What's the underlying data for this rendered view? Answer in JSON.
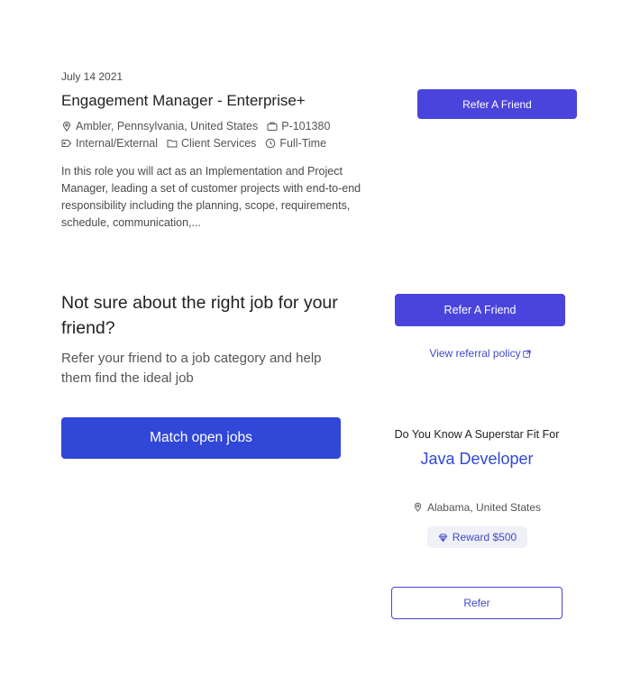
{
  "job": {
    "date": "July 14 2021",
    "title": "Engagement Manager - Enterprise+",
    "location": "Ambler, Pennsylvania, United States",
    "id": "P-101380",
    "type": "Internal/External",
    "department": "Client Services",
    "schedule": "Full-Time",
    "description": "In this role you will act as an Implementation and Project Manager, leading a set of customer projects with end-to-end responsibility including the planning, scope, requirements, schedule, communication,...",
    "refer_label": "Refer A Friend"
  },
  "not_sure": {
    "title": "Not sure about the right job for your friend?",
    "subtitle": "Refer your friend to a job category and help them find the ideal job",
    "match_label": "Match open jobs",
    "refer_label": "Refer A Friend",
    "policy_label": "View referral policy"
  },
  "superstar": {
    "heading": "Do You Know A Superstar Fit For",
    "role": "Java Developer",
    "location": "Alabama, United States",
    "reward": "Reward $500",
    "refer_label": "Refer"
  },
  "icons": {
    "location": "location-pin-icon",
    "id": "briefcase-icon",
    "type": "tag-icon",
    "department": "folder-icon",
    "schedule": "clock-icon",
    "external": "external-link-icon",
    "reward": "diamond-icon"
  },
  "colors": {
    "primary": "#4a43dc",
    "match_button": "#3147d8",
    "link": "#3f49c9",
    "badge_bg": "#f0f1f7"
  }
}
